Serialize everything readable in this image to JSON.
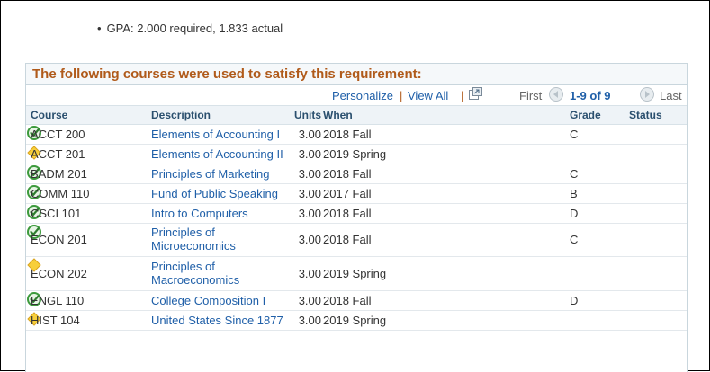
{
  "gpa": {
    "bullet": "•",
    "text": "GPA: 2.000 required, 1.833 actual"
  },
  "grid": {
    "title": "The following courses were used to satisfy this requirement:",
    "nav": {
      "personalize": "Personalize",
      "sep": "|",
      "view_all": "View All",
      "first": "First",
      "range": "1-9 of 9",
      "last": "Last"
    },
    "columns": {
      "course": "Course",
      "description": "Description",
      "units": "Units",
      "when": "When",
      "grade": "Grade",
      "status": "Status"
    },
    "rows": [
      {
        "course": "ACCT 200",
        "description": "Elements of Accounting I",
        "units": "3.00",
        "when": "2018 Fall",
        "grade": "C",
        "status": "complete"
      },
      {
        "course": "ACCT 201",
        "description": "Elements of Accounting II",
        "units": "3.00",
        "when": "2019 Spring",
        "grade": "",
        "status": "in-progress"
      },
      {
        "course": "BADM 201",
        "description": "Principles of Marketing",
        "units": "3.00",
        "when": "2018 Fall",
        "grade": "C",
        "status": "complete"
      },
      {
        "course": "COMM 110",
        "description": "Fund of Public Speaking",
        "units": "3.00",
        "when": "2017 Fall",
        "grade": "B",
        "status": "complete"
      },
      {
        "course": "CSCI 101",
        "description": "Intro to Computers",
        "units": "3.00",
        "when": "2018 Fall",
        "grade": "D",
        "status": "complete"
      },
      {
        "course": "ECON 201",
        "description": "Principles of Microeconomics",
        "description_line1": "Principles of",
        "description_line2": "Microeconomics",
        "units": "3.00",
        "when": "2018 Fall",
        "grade": "C",
        "status": "complete"
      },
      {
        "course": "ECON 202",
        "description": "Principles of Macroeconomics",
        "description_line1": "Principles of",
        "description_line2": "Macroeconomics",
        "units": "3.00",
        "when": "2019 Spring",
        "grade": "",
        "status": "in-progress"
      },
      {
        "course": "ENGL 110",
        "description": "College Composition I",
        "units": "3.00",
        "when": "2018 Fall",
        "grade": "D",
        "status": "complete"
      },
      {
        "course": "HIST 104",
        "description": "United States Since 1877",
        "units": "3.00",
        "when": "2019 Spring",
        "grade": "",
        "status": "in-progress"
      }
    ]
  },
  "colors": {
    "title": "#b05a1a",
    "link": "#1f5fa8",
    "status_complete": "#3c9a3c",
    "status_in_progress": "#f2c230"
  },
  "icons": {
    "complete": "check-circle-icon",
    "in_progress": "diamond-icon",
    "popout": "popout-window-icon",
    "prev": "previous-arrow-icon",
    "next": "next-arrow-icon"
  }
}
